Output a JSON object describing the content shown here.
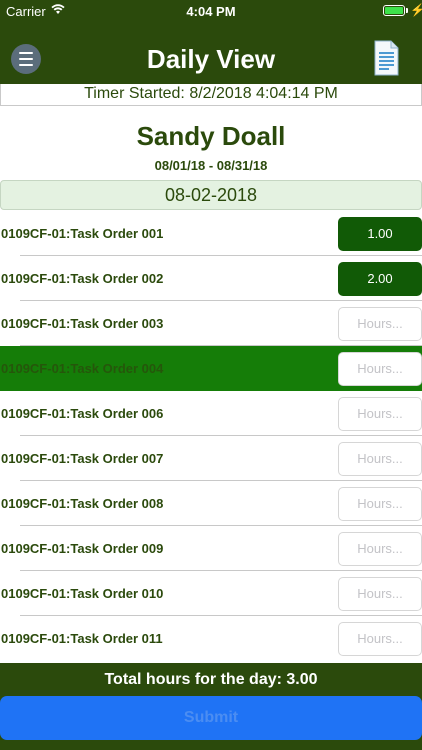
{
  "status_bar": {
    "carrier": "Carrier",
    "time": "4:04 PM"
  },
  "header": {
    "title": "Daily View"
  },
  "timer": {
    "text": "Timer Started: 8/2/2018 4:04:14 PM"
  },
  "employee": {
    "name": "Sandy Doall",
    "period": "08/01/18 - 08/31/18"
  },
  "date": {
    "current": "08-02-2018"
  },
  "tasks": [
    {
      "label": "0109CF-01:Task Order 001",
      "hours": "1.00",
      "placeholder": ""
    },
    {
      "label": "0109CF-01:Task Order 002",
      "hours": "2.00",
      "placeholder": ""
    },
    {
      "label": "0109CF-01:Task Order 003",
      "hours": "",
      "placeholder": "Hours..."
    },
    {
      "label": "0109CF-01:Task Order 004",
      "hours": "",
      "placeholder": "Hours..."
    },
    {
      "label": "0109CF-01:Task Order 006",
      "hours": "",
      "placeholder": "Hours..."
    },
    {
      "label": "0109CF-01:Task Order 007",
      "hours": "",
      "placeholder": "Hours..."
    },
    {
      "label": "0109CF-01:Task Order 008",
      "hours": "",
      "placeholder": "Hours..."
    },
    {
      "label": "0109CF-01:Task Order 009",
      "hours": "",
      "placeholder": "Hours..."
    },
    {
      "label": "0109CF-01:Task Order 010",
      "hours": "",
      "placeholder": "Hours..."
    },
    {
      "label": "0109CF-01:Task Order 011",
      "hours": "",
      "placeholder": "Hours..."
    }
  ],
  "footer": {
    "total_text": "Total hours for the day: 3.00",
    "submit_label": "Submit"
  },
  "icons": {
    "menu": "hamburger-menu-icon",
    "report": "document-icon",
    "wifi": "wifi-icon",
    "battery": "battery-icon"
  },
  "colors": {
    "header_green": "#2b4a0c",
    "selected_row": "#157d08",
    "filled_hours": "#115a06",
    "submit_blue": "#1f73f5"
  }
}
